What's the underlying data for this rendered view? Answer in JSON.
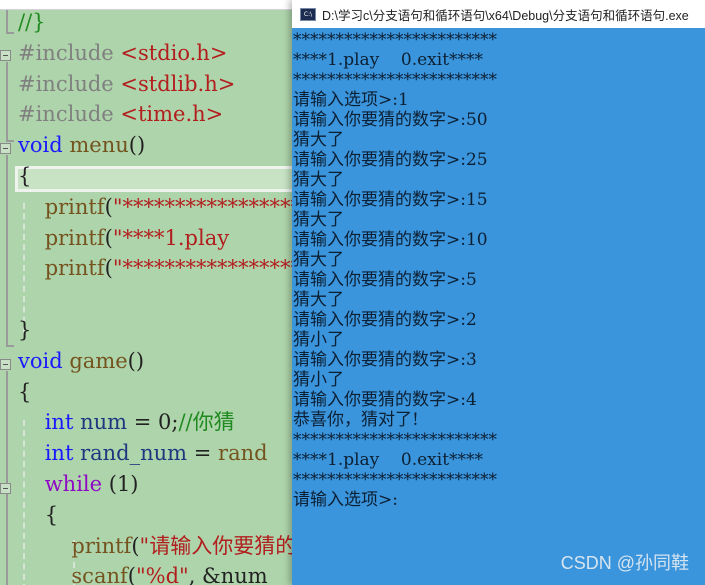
{
  "editor": {
    "lines": [
      {
        "tokens": [
          {
            "t": "//}",
            "c": "cm"
          }
        ]
      },
      {
        "tokens": [
          {
            "t": "#include ",
            "c": "pp"
          },
          {
            "t": "<stdio.h>",
            "c": "inc"
          }
        ]
      },
      {
        "tokens": [
          {
            "t": "#include ",
            "c": "pp"
          },
          {
            "t": "<stdlib.h>",
            "c": "inc"
          }
        ]
      },
      {
        "tokens": [
          {
            "t": "#include ",
            "c": "pp"
          },
          {
            "t": "<time.h>",
            "c": "inc"
          }
        ]
      },
      {
        "tokens": [
          {
            "t": "void",
            "c": "kw"
          },
          {
            "t": " ",
            "c": "pl"
          },
          {
            "t": "menu",
            "c": "fn"
          },
          {
            "t": "()",
            "c": "pl"
          }
        ]
      },
      {
        "tokens": [
          {
            "t": "{",
            "c": "pl"
          }
        ]
      },
      {
        "tokens": [
          {
            "t": "    printf",
            "c": "fn"
          },
          {
            "t": "(",
            "c": "pl"
          },
          {
            "t": "\"************************",
            "c": "str"
          }
        ]
      },
      {
        "tokens": [
          {
            "t": "    printf",
            "c": "fn"
          },
          {
            "t": "(",
            "c": "pl"
          },
          {
            "t": "\"****1.play",
            "c": "str"
          }
        ]
      },
      {
        "tokens": [
          {
            "t": "    printf",
            "c": "fn"
          },
          {
            "t": "(",
            "c": "pl"
          },
          {
            "t": "\"************************",
            "c": "str"
          }
        ]
      },
      {
        "tokens": [
          {
            "t": "",
            "c": "pl"
          }
        ]
      },
      {
        "tokens": [
          {
            "t": "}",
            "c": "pl"
          }
        ]
      },
      {
        "tokens": [
          {
            "t": "void",
            "c": "kw"
          },
          {
            "t": " ",
            "c": "pl"
          },
          {
            "t": "game",
            "c": "fn"
          },
          {
            "t": "()",
            "c": "pl"
          }
        ]
      },
      {
        "tokens": [
          {
            "t": "{",
            "c": "pl"
          }
        ]
      },
      {
        "tokens": [
          {
            "t": "    ",
            "c": "pl"
          },
          {
            "t": "int",
            "c": "kw"
          },
          {
            "t": " ",
            "c": "pl"
          },
          {
            "t": "num",
            "c": "var"
          },
          {
            "t": " = 0;",
            "c": "pl"
          },
          {
            "t": "//你猜",
            "c": "cm"
          }
        ]
      },
      {
        "tokens": [
          {
            "t": "    ",
            "c": "pl"
          },
          {
            "t": "int",
            "c": "kw"
          },
          {
            "t": " ",
            "c": "pl"
          },
          {
            "t": "rand_num",
            "c": "var"
          },
          {
            "t": " = ",
            "c": "pl"
          },
          {
            "t": "rand",
            "c": "fn"
          }
        ]
      },
      {
        "tokens": [
          {
            "t": "    ",
            "c": "pl"
          },
          {
            "t": "while",
            "c": "ctl"
          },
          {
            "t": " (1)",
            "c": "pl"
          }
        ]
      },
      {
        "tokens": [
          {
            "t": "    {",
            "c": "pl"
          }
        ]
      },
      {
        "tokens": [
          {
            "t": "        printf",
            "c": "fn"
          },
          {
            "t": "(",
            "c": "pl"
          },
          {
            "t": "\"请输入你要猜的数字",
            "c": "str"
          }
        ]
      },
      {
        "tokens": [
          {
            "t": "        scanf",
            "c": "fn"
          },
          {
            "t": "(",
            "c": "pl"
          },
          {
            "t": "\"%d\"",
            "c": "str"
          },
          {
            "t": ", &num",
            "c": "pl"
          }
        ]
      }
    ]
  },
  "console": {
    "title": "D:\\学习c\\分支语句和循环语句\\x64\\Debug\\分支语句和循环语句.exe",
    "icon": "console-app-icon",
    "icon_label": "C:\\",
    "output_lines": [
      "************************",
      "****1.play    0.exit****",
      "************************",
      "请输入选项>:1",
      "请输入你要猜的数字>:50",
      "猜大了",
      "请输入你要猜的数字>:25",
      "猜大了",
      "请输入你要猜的数字>:15",
      "猜大了",
      "请输入你要猜的数字>:10",
      "猜大了",
      "请输入你要猜的数字>:5",
      "猜大了",
      "请输入你要猜的数字>:2",
      "猜小了",
      "请输入你要猜的数字>:3",
      "猜小了",
      "请输入你要猜的数字>:4",
      "恭喜你，猜对了!",
      "************************",
      "****1.play    0.exit****",
      "************************",
      "请输入选项>:"
    ]
  },
  "watermark": "CSDN @孙同鞋",
  "colors": {
    "editor_bg": "#aed4ab",
    "console_bg": "#3a95dc",
    "keyword": "#1a1aff",
    "string": "#b21e1e",
    "comment": "#1f8a1f"
  }
}
